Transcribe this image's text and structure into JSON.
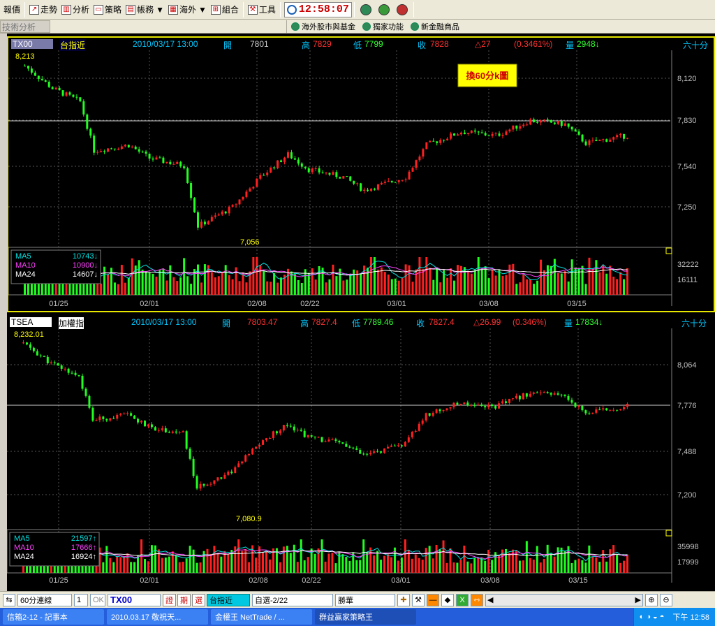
{
  "toolbar": {
    "items": [
      "報價",
      "走勢",
      "分析",
      "策略",
      "帳務",
      "海外",
      "組合",
      "工具"
    ],
    "clock": "12:58:07"
  },
  "row2": {
    "left_label": "技術分析",
    "links": [
      "海外股市與基金",
      "獨家功能",
      "新金融商品"
    ]
  },
  "panel1": {
    "symbol": "TX00",
    "name": "台指近",
    "datetime": "2010/03/17 13:00",
    "open_label": "開",
    "open": "7801",
    "high_label": "高",
    "high": "7829",
    "low_label": "低",
    "low": "7799",
    "close_label": "收",
    "close": "7828",
    "change": "△27",
    "pct": "(0.3461%)",
    "vol_label": "量",
    "vol": "2948↓",
    "interval": "六十分",
    "max_label": "8,213",
    "min_label": "7,056",
    "price_ticks": [
      "8,120",
      "7,830",
      "7,540",
      "7,250"
    ],
    "last_price_mark": "7,830",
    "annotation": "換60分k圖",
    "vol_ticks": [
      "32222",
      "16111"
    ],
    "ma5_label": "MA5",
    "ma5": "10743↓",
    "ma10_label": "MA10",
    "ma10": "10900↓",
    "ma24_label": "MA24",
    "ma24": "14607↓",
    "dates": [
      "01/25",
      "02/01",
      "02/08",
      "02/22",
      "03/01",
      "03/08",
      "03/15"
    ]
  },
  "panel2": {
    "symbol": "TSEA",
    "name": "加權指",
    "datetime": "2010/03/17 13:00",
    "open_label": "開",
    "open": "7803.47",
    "high_label": "高",
    "high": "7827.4",
    "low_label": "低",
    "low": "7789.46",
    "close_label": "收",
    "close": "7827.4",
    "change": "△26.99",
    "pct": "(0.346%)",
    "vol_label": "量",
    "vol": "17834↓",
    "interval": "六十分",
    "max_label": "8,232.01",
    "min_label": "7,080.9",
    "price_ticks": [
      "8,064",
      "7,776",
      "7,488",
      "7,200"
    ],
    "vol_ticks": [
      "35998",
      "17999"
    ],
    "ma5_label": "MA5",
    "ma5": "21597↑",
    "ma10_label": "MA10",
    "ma10": "17666↑",
    "ma24_label": "MA24",
    "ma24": "16924↑",
    "dates": [
      "01/25",
      "02/01",
      "02/08",
      "02/22",
      "03/01",
      "03/08",
      "03/15"
    ]
  },
  "bottombar": {
    "period": "60分連線",
    "count": "1",
    "ok": "OK",
    "symbol": "TX00",
    "b1": "證",
    "b2": "期",
    "b3": "選",
    "name": "台指近",
    "group": "自選-2/22",
    "broker": "勝華"
  },
  "taskbar": {
    "tasks": [
      "信箱2-12 - 記事本",
      "2010.03.17 敬祝天...",
      "金權王 NetTrade / ...",
      "群益贏家策略王"
    ],
    "time": "下午 12:58"
  },
  "colors": {
    "up": "#ff2020",
    "down": "#20ff20",
    "ma5": "#00e0e0",
    "ma10": "#ff40ff",
    "ma24": "#ffffff"
  }
}
